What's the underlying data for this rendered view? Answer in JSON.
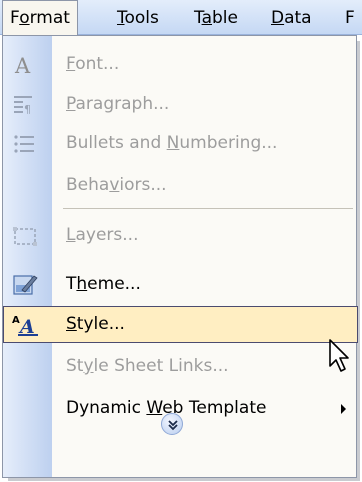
{
  "menubar": {
    "items": [
      {
        "label_pre": "F",
        "label_u": "o",
        "label_post": "rmat"
      },
      {
        "label_pre": "",
        "label_u": "T",
        "label_post": "ools"
      },
      {
        "label_pre": "T",
        "label_u": "a",
        "label_post": "ble"
      },
      {
        "label_pre": "",
        "label_u": "D",
        "label_post": "ata"
      },
      {
        "label_pre": "F",
        "label_u": "",
        "label_post": ""
      }
    ]
  },
  "menu": {
    "items": [
      {
        "label_pre": "",
        "label_u": "F",
        "label_post": "ont...",
        "icon": "font-icon",
        "enabled": false
      },
      {
        "label_pre": "",
        "label_u": "P",
        "label_post": "aragraph...",
        "icon": "paragraph-icon",
        "enabled": false
      },
      {
        "label_pre": "Bullets and ",
        "label_u": "N",
        "label_post": "umbering...",
        "icon": "bullets-icon",
        "enabled": false
      },
      {
        "label_pre": "Beha",
        "label_u": "v",
        "label_post": "iors...",
        "icon": "",
        "enabled": false
      },
      {
        "label_pre": "",
        "label_u": "L",
        "label_post": "ayers...",
        "icon": "layers-icon",
        "enabled": false
      },
      {
        "label_pre": "T",
        "label_u": "h",
        "label_post": "eme...",
        "icon": "theme-icon",
        "enabled": true
      },
      {
        "label_pre": "",
        "label_u": "S",
        "label_post": "tyle...",
        "icon": "style-icon",
        "enabled": true,
        "highlighted": true
      },
      {
        "label_pre": "St",
        "label_u": "y",
        "label_post": "le Sheet Links...",
        "icon": "",
        "enabled": false
      },
      {
        "label_pre": "Dynamic ",
        "label_u": "W",
        "label_post": "eb Template",
        "icon": "",
        "enabled": true,
        "submenu": true
      }
    ]
  },
  "icons": {
    "expand": "double-chevron-down-icon",
    "cursor": "mouse-pointer-icon",
    "submenu": "submenu-arrow-icon"
  },
  "colors": {
    "highlight": "#ffeec2",
    "disabled_text": "#9d9d9d",
    "gutter": "#bdd0ef"
  }
}
